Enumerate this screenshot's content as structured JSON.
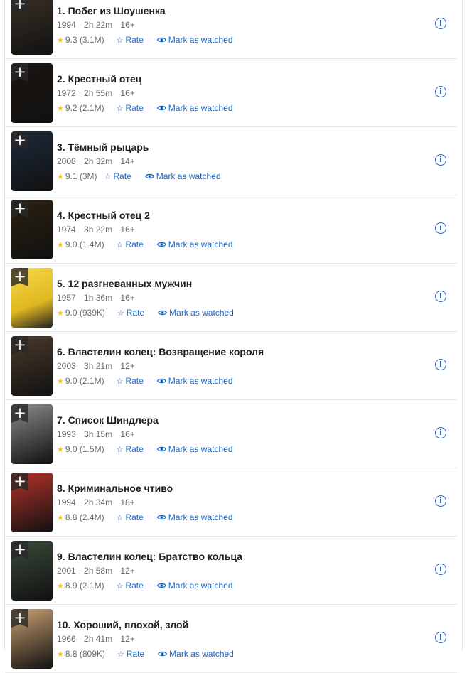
{
  "labels": {
    "rate": "Rate",
    "watched": "Mark as watched"
  },
  "movies": [
    {
      "title": "1. Побег из Шоушенка",
      "year": "1994",
      "duration": "2h 22m",
      "age": "16+",
      "rating": "9.3 (3.1M)",
      "poster": "#3a3126"
    },
    {
      "title": "2. Крестный отец",
      "year": "1972",
      "duration": "2h 55m",
      "age": "16+",
      "rating": "9.2 (2.1M)",
      "poster": "#1a1410"
    },
    {
      "title": "3. Тёмный рыцарь",
      "year": "2008",
      "duration": "2h 32m",
      "age": "14+",
      "rating": "9.1 (3M)",
      "poster": "#1c2a3a"
    },
    {
      "title": "4. Крестный отец 2",
      "year": "1974",
      "duration": "3h 22m",
      "age": "16+",
      "rating": "9.0 (1.4M)",
      "poster": "#2a2010"
    },
    {
      "title": "5. 12 разгневанных мужчин",
      "year": "1957",
      "duration": "1h 36m",
      "age": "16+",
      "rating": "9.0 (939K)",
      "poster": "#f2d63a"
    },
    {
      "title": "6. Властелин колец: Возвращение короля",
      "year": "2003",
      "duration": "3h 21m",
      "age": "12+",
      "rating": "9.0 (2.1M)",
      "poster": "#4a3a2a"
    },
    {
      "title": "7. Список Шиндлера",
      "year": "1993",
      "duration": "3h 15m",
      "age": "16+",
      "rating": "9.0 (1.5M)",
      "poster": "#8a8a8a"
    },
    {
      "title": "8. Криминальное чтиво",
      "year": "1994",
      "duration": "2h 34m",
      "age": "18+",
      "rating": "8.8 (2.4M)",
      "poster": "#b8322a"
    },
    {
      "title": "9. Властелин колец: Братство кольца",
      "year": "2001",
      "duration": "2h 58m",
      "age": "12+",
      "rating": "8.9 (2.1M)",
      "poster": "#3a4a3a"
    },
    {
      "title": "10. Хороший, плохой, злой",
      "year": "1966",
      "duration": "2h 41m",
      "age": "12+",
      "rating": "8.8 (809K)",
      "poster": "#c9a070"
    }
  ]
}
